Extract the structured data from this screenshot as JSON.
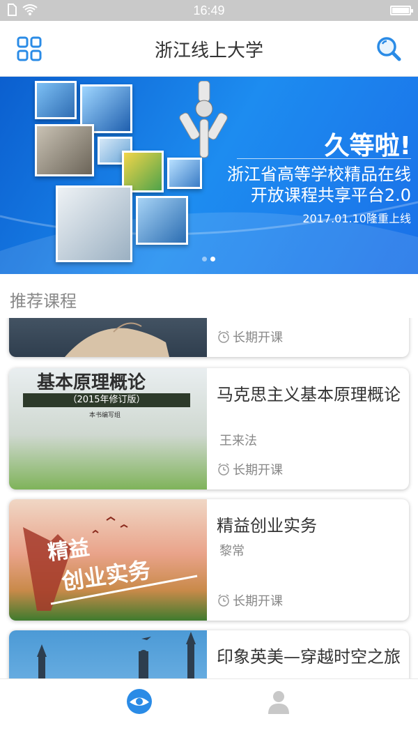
{
  "status_bar": {
    "time": "16:49",
    "battery_level": 1.0
  },
  "app_bar": {
    "title": "浙江线上大学",
    "menu_icon": "grid-icon",
    "search_icon": "search-icon"
  },
  "banner": {
    "headline": "久等啦!",
    "line1": "浙江省高等学校精品在线",
    "line2": "开放课程共享平台2.0",
    "date_text": "2017.01.10隆重上线",
    "page_count": 2,
    "active_page": 1
  },
  "section": {
    "title": "推荐课程"
  },
  "courses": [
    {
      "title": "",
      "teacher": "",
      "schedule": "长期开课",
      "thumb_text": ""
    },
    {
      "title": "马克思主义基本原理概论",
      "teacher": "王来法",
      "schedule": "长期开课",
      "thumb_text": "基本原理概论",
      "thumb_sub": "（2015年修订版）",
      "thumb_sub2": "本书编写组"
    },
    {
      "title": "精益创业实务",
      "teacher": "黎常",
      "schedule": "长期开课",
      "thumb_text": "精益",
      "thumb_text2": "创业实务"
    },
    {
      "title": "印象英美—穿越时空之旅",
      "teacher": "",
      "schedule": "",
      "thumb_text": ""
    }
  ],
  "bottom_nav": [
    {
      "icon": "eye-icon",
      "active": true,
      "color": "#2a8be6"
    },
    {
      "icon": "profile-icon",
      "active": false,
      "color": "#c8c8c8"
    }
  ],
  "colors": {
    "accent": "#2a8be6",
    "banner_blue": "#1d8cf0"
  }
}
